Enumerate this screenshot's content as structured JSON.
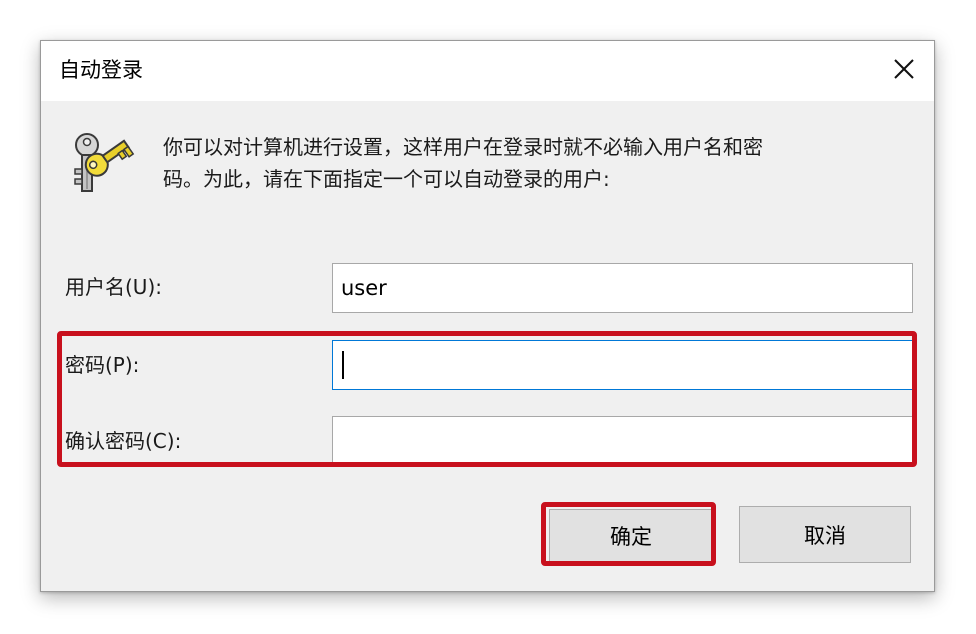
{
  "window": {
    "title": "自动登录",
    "close_icon": "close-icon"
  },
  "description": {
    "icon": "keys-icon",
    "line1": "你可以对计算机进行设置，这样用户在登录时就不必输入用户名和密",
    "line2": "码。为此，请在下面指定一个可以自动登录的用户:"
  },
  "form": {
    "username_label": "用户名(U):",
    "username_value": "user",
    "password_label": "密码(P):",
    "password_value": "",
    "confirm_label": "确认密码(C):",
    "confirm_value": ""
  },
  "buttons": {
    "ok_label": "确定",
    "cancel_label": "取消"
  },
  "colors": {
    "highlight": "#c8101d",
    "focus_border": "#0078d7",
    "dialog_bg": "#f0f0f0"
  }
}
